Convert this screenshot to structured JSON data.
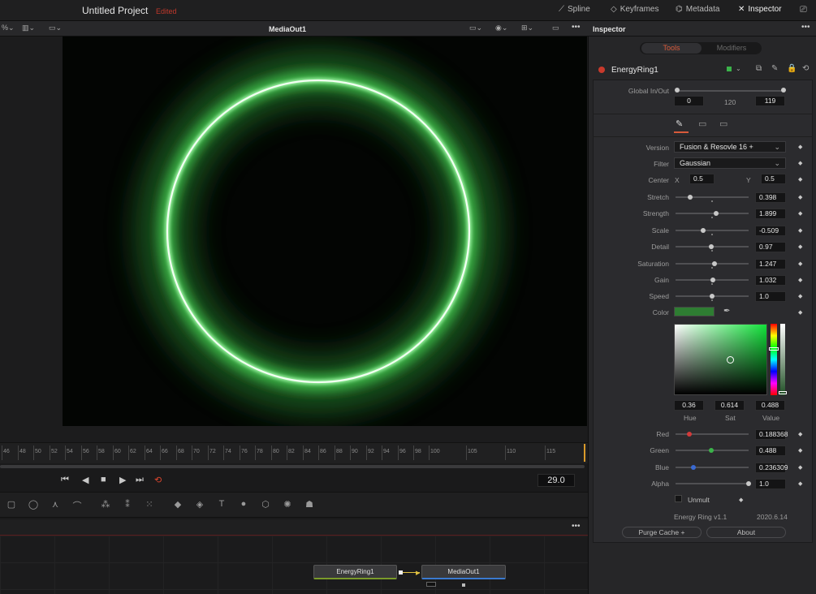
{
  "app": {
    "project_title": "Untitled Project",
    "project_status": "Edited",
    "top_buttons": [
      "Spline",
      "Keyframes",
      "Metadata",
      "Inspector"
    ]
  },
  "viewer": {
    "title": "MediaOut1",
    "frame": "29.0"
  },
  "timeline": {
    "ticks": [
      "46",
      "48",
      "50",
      "52",
      "54",
      "56",
      "58",
      "60",
      "62",
      "64",
      "66",
      "68",
      "70",
      "72",
      "74",
      "76",
      "78",
      "80",
      "82",
      "84",
      "86",
      "88",
      "90",
      "92",
      "94",
      "96",
      "98",
      "100",
      "105",
      "110",
      "115"
    ]
  },
  "nodes": {
    "source": "EnergyRing1",
    "output": "MediaOut1"
  },
  "inspector": {
    "title": "Inspector",
    "tab_tools": "Tools",
    "tab_modifiers": "Modifiers",
    "tool_name": "EnergyRing1",
    "global_label": "Global In/Out",
    "global_in": "0",
    "global_mid": "120",
    "global_out": "119",
    "version_label": "Version",
    "version_value": "Fusion & Resovle 16 +",
    "filter_label": "Filter",
    "filter_value": "Gaussian",
    "center_label": "Center",
    "center_x_label": "X",
    "center_x": "0.5",
    "center_y_label": "Y",
    "center_y": "0.5",
    "params": [
      {
        "label": "Stretch",
        "value": "0.398",
        "level": 0.2
      },
      {
        "label": "Strength",
        "value": "1.899",
        "level": 0.55
      },
      {
        "label": "Scale",
        "value": "-0.509",
        "level": 0.38
      },
      {
        "label": "Detail",
        "value": "0.97",
        "level": 0.49
      },
      {
        "label": "Saturation",
        "value": "1.247",
        "level": 0.53
      },
      {
        "label": "Gain",
        "value": "1.032",
        "level": 0.51
      },
      {
        "label": "Speed",
        "value": "1.0",
        "level": 0.5
      }
    ],
    "color_label": "Color",
    "color_swatch": "#2e7d32",
    "hue": "0.36",
    "sat": "0.614",
    "value": "0.488",
    "hue_label": "Hue",
    "sat_label": "Sat",
    "value_label": "Value",
    "channels": [
      {
        "label": "Red",
        "value": "0.188368",
        "level": 0.19,
        "color": "#d23a3a"
      },
      {
        "label": "Green",
        "value": "0.488",
        "level": 0.49,
        "color": "#3bb34a"
      },
      {
        "label": "Blue",
        "value": "0.236309",
        "level": 0.24,
        "color": "#3a6ad2"
      },
      {
        "label": "Alpha",
        "value": "1.0",
        "level": 1.0,
        "color": "#c8c8c8"
      }
    ],
    "unmult_label": "Unmult",
    "footer_name": "Energy Ring  v1.1",
    "footer_date": "2020.6.14",
    "purge_label": "Purge Cache +",
    "about_label": "About"
  }
}
